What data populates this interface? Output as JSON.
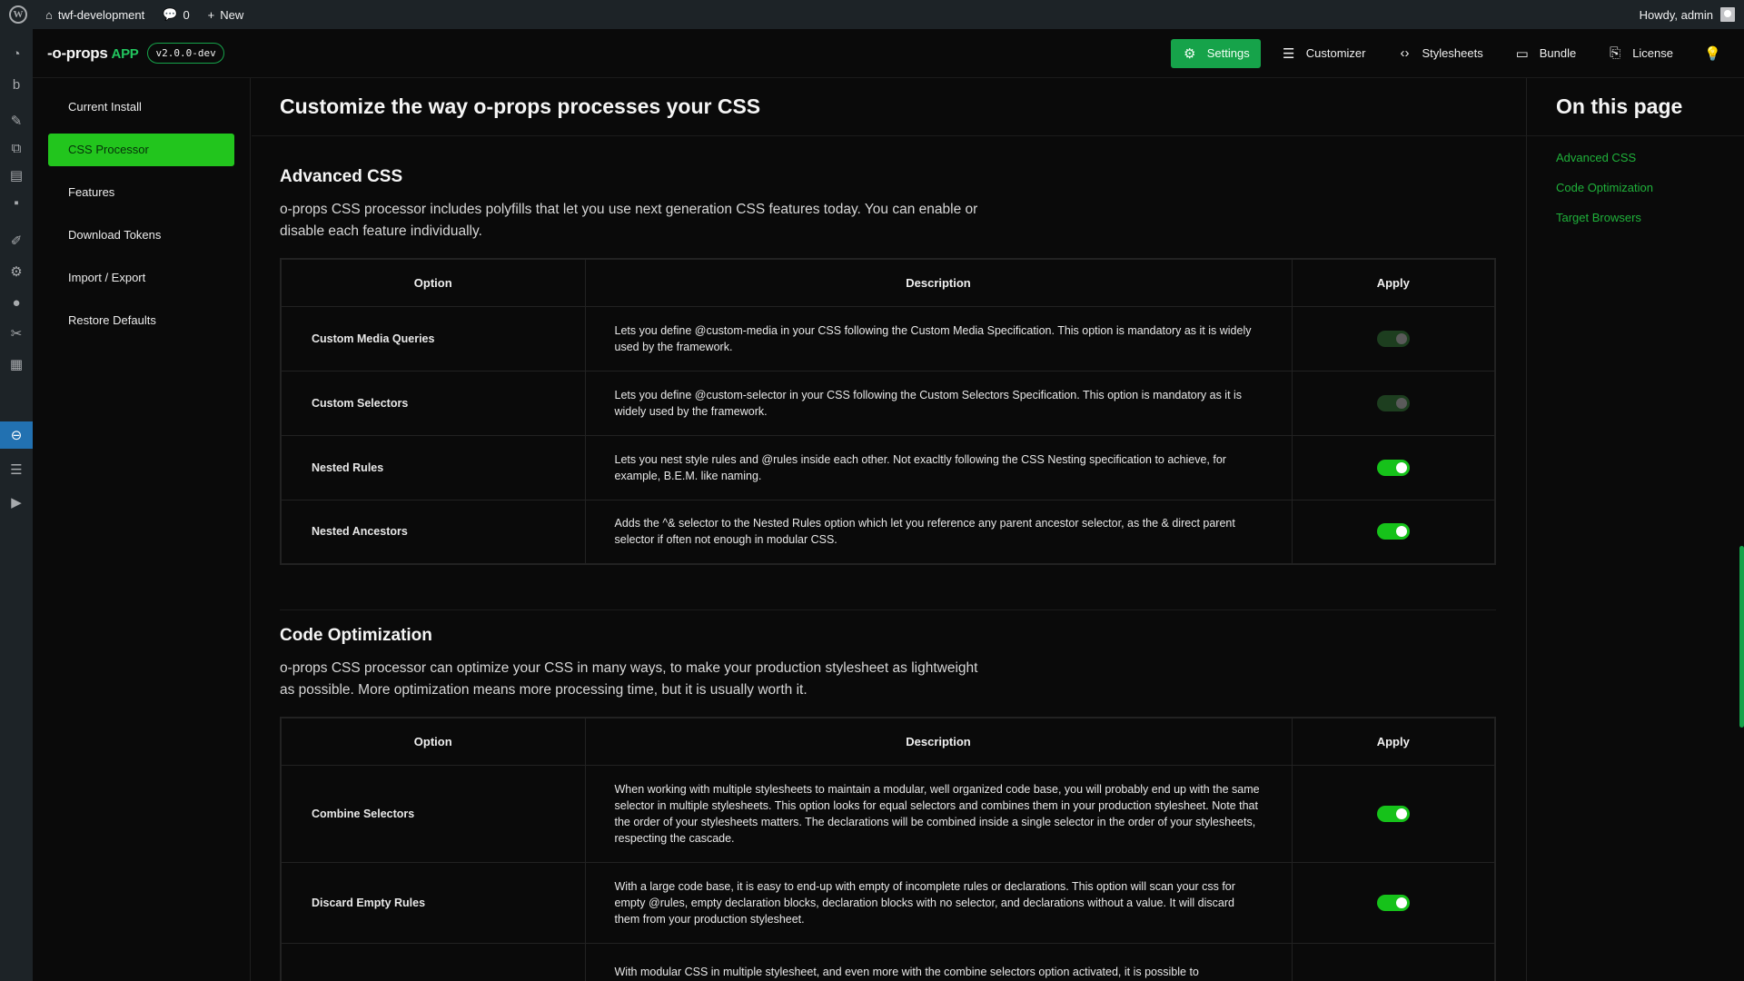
{
  "adminbar": {
    "site_name": "twf-development",
    "comments_count": "0",
    "new_label": "New",
    "howdy": "Howdy, admin"
  },
  "app": {
    "brand_name": "-o-props",
    "brand_suffix": "APP",
    "version": "v2.0.0-dev",
    "accent_color": "#16a34a"
  },
  "topnav": {
    "settings": "Settings",
    "customizer": "Customizer",
    "stylesheets": "Stylesheets",
    "bundle": "Bundle",
    "license": "License"
  },
  "sidebar": {
    "items": [
      {
        "label": "Current Install"
      },
      {
        "label": "CSS Processor"
      },
      {
        "label": "Features"
      },
      {
        "label": "Download Tokens"
      },
      {
        "label": "Import / Export"
      },
      {
        "label": "Restore Defaults"
      }
    ],
    "active_index": 1
  },
  "main": {
    "title": "Customize the way o-props processes your CSS",
    "sections": [
      {
        "heading": "Advanced CSS",
        "lead": "o-props CSS processor includes polyfills that let you use next generation CSS features today. You can enable or disable each feature individually.",
        "columns": {
          "option": "Option",
          "description": "Description",
          "apply": "Apply"
        },
        "rows": [
          {
            "option": "Custom Media Queries",
            "description": "Lets you define @custom-media in your CSS following the Custom Media Specification. This option is mandatory as it is widely used by the framework.",
            "enabled": true,
            "locked": true
          },
          {
            "option": "Custom Selectors",
            "description": "Lets you define @custom-selector in your CSS following the Custom Selectors Specification. This option is mandatory as it is widely used by the framework.",
            "enabled": true,
            "locked": true
          },
          {
            "option": "Nested Rules",
            "description": "Lets you nest style rules and @rules inside each other. Not exacltly following the CSS Nesting specification to achieve, for example, B.E.M. like naming.",
            "enabled": true,
            "locked": false
          },
          {
            "option": "Nested Ancestors",
            "description": "Adds the ^& selector to the Nested Rules option which let you reference any parent ancestor selector, as the & direct parent selector if often not enough in modular CSS.",
            "enabled": true,
            "locked": false
          }
        ]
      },
      {
        "heading": "Code Optimization",
        "lead": "o-props CSS processor can optimize your CSS in many ways, to make your production stylesheet as lightweight as possible. More optimization means more processing time, but it is usually worth it.",
        "columns": {
          "option": "Option",
          "description": "Description",
          "apply": "Apply"
        },
        "rows": [
          {
            "option": "Combine Selectors",
            "description": "When working with multiple stylesheets to maintain a modular, well organized code base, you will probably end up with the same selector in multiple stylesheets. This option looks for equal selectors and combines them in your production stylesheet. Note that the order of your stylesheets matters. The declarations will be combined inside a single selector in the order of your stylesheets, respecting the cascade.",
            "enabled": true,
            "locked": false
          },
          {
            "option": "Discard Empty Rules",
            "description": "With a large code base, it is easy to end-up with empty of incomplete rules or declarations. This option will scan your css for empty @rules, empty declaration blocks, declaration blocks with no selector, and declarations without a value. It will discard them from your production stylesheet.",
            "enabled": true,
            "locked": false
          },
          {
            "option": "",
            "description": "With modular CSS in multiple stylesheet, and even more with the combine selectors option activated, it is possible to",
            "enabled": true,
            "locked": false
          }
        ]
      }
    ]
  },
  "toc": {
    "title": "On this page",
    "links": [
      "Advanced CSS",
      "Code Optimization",
      "Target Browsers"
    ]
  }
}
